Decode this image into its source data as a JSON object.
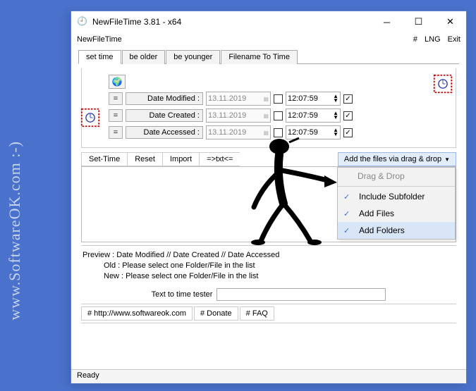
{
  "watermark": "www.SoftwareOK.com :-)",
  "window": {
    "title": "NewFileTime 3.81 - x64"
  },
  "menubar": {
    "app": "NewFileTime",
    "hash": "#",
    "lng": "LNG",
    "exit": "Exit"
  },
  "tabs": [
    "set time",
    "be older",
    "be younger",
    "Filename To Time"
  ],
  "rows": {
    "modified": {
      "label": "Date Modified :",
      "date": "13.11.2019",
      "time": "12:07:59"
    },
    "created": {
      "label": "Date Created :",
      "date": "13.11.2019",
      "time": "12:07:59"
    },
    "accessed": {
      "label": "Date Accessed :",
      "date": "13.11.2019",
      "time": "12:07:59"
    }
  },
  "toolbar": {
    "set_time": "Set-Time",
    "reset": "Reset",
    "import": "Import",
    "txt": "=>txt<=",
    "add_drop": "Add the files via drag & drop"
  },
  "dropdown": {
    "header": "Drag & Drop",
    "include_subfolder": "Include Subfolder",
    "add_files": "Add Files",
    "add_folders": "Add Folders"
  },
  "preview": {
    "header": "Preview  :   Date Modified    //   Date Created    //   Date Accessed",
    "old": "Old :  Please select one Folder/File in the list",
    "new": "New :  Please select one Folder/File in the list"
  },
  "tester_label": "Text to time tester",
  "links": {
    "site": "# http://www.softwareok.com",
    "donate": "# Donate",
    "faq": "# FAQ"
  },
  "status": "Ready",
  "eq": "="
}
